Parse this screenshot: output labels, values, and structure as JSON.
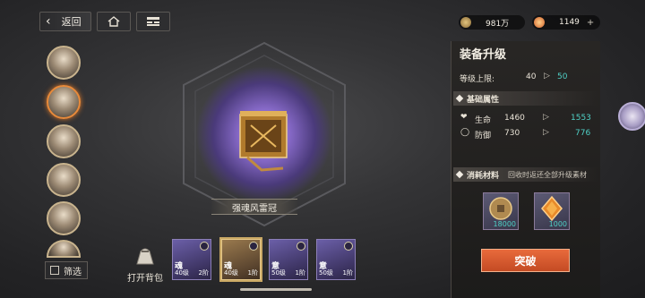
{
  "topbar": {
    "back_label": "返回"
  },
  "currency": [
    {
      "amount": "981万",
      "icon": "coin-icon",
      "color": "#b08a50"
    },
    {
      "amount": "1149",
      "icon": "star-gem-icon",
      "color": "#e07a30"
    }
  ],
  "sidebar": {
    "filter_label": "筛选"
  },
  "item": {
    "name": "强魂风雷冠"
  },
  "inventory": {
    "bag_label": "打开背包",
    "slots": [
      {
        "type": "魂",
        "level": "40级",
        "tier": "2阶"
      },
      {
        "type": "魂",
        "level": "40级",
        "tier": "1阶"
      },
      {
        "type": "意",
        "level": "50级",
        "tier": "1阶"
      },
      {
        "type": "意",
        "level": "50级",
        "tier": "1阶"
      }
    ]
  },
  "panel": {
    "title": "装备升级",
    "level_label": "等级上限:",
    "level_from": "40",
    "level_to": "50",
    "attr_header": "基础属性",
    "attrs": [
      {
        "name": "生命",
        "from": "1460",
        "to": "1553",
        "icon": "heart-icon"
      },
      {
        "name": "防御",
        "from": "730",
        "to": "776",
        "icon": "shield-icon"
      }
    ],
    "mat_header": "消耗材料",
    "mat_note": "回收时返还全部升级素材",
    "materials": [
      {
        "count": "18000",
        "icon": "coin-icon"
      },
      {
        "count": "1000",
        "icon": "amber-gem-icon"
      }
    ],
    "break_label": "突破"
  }
}
